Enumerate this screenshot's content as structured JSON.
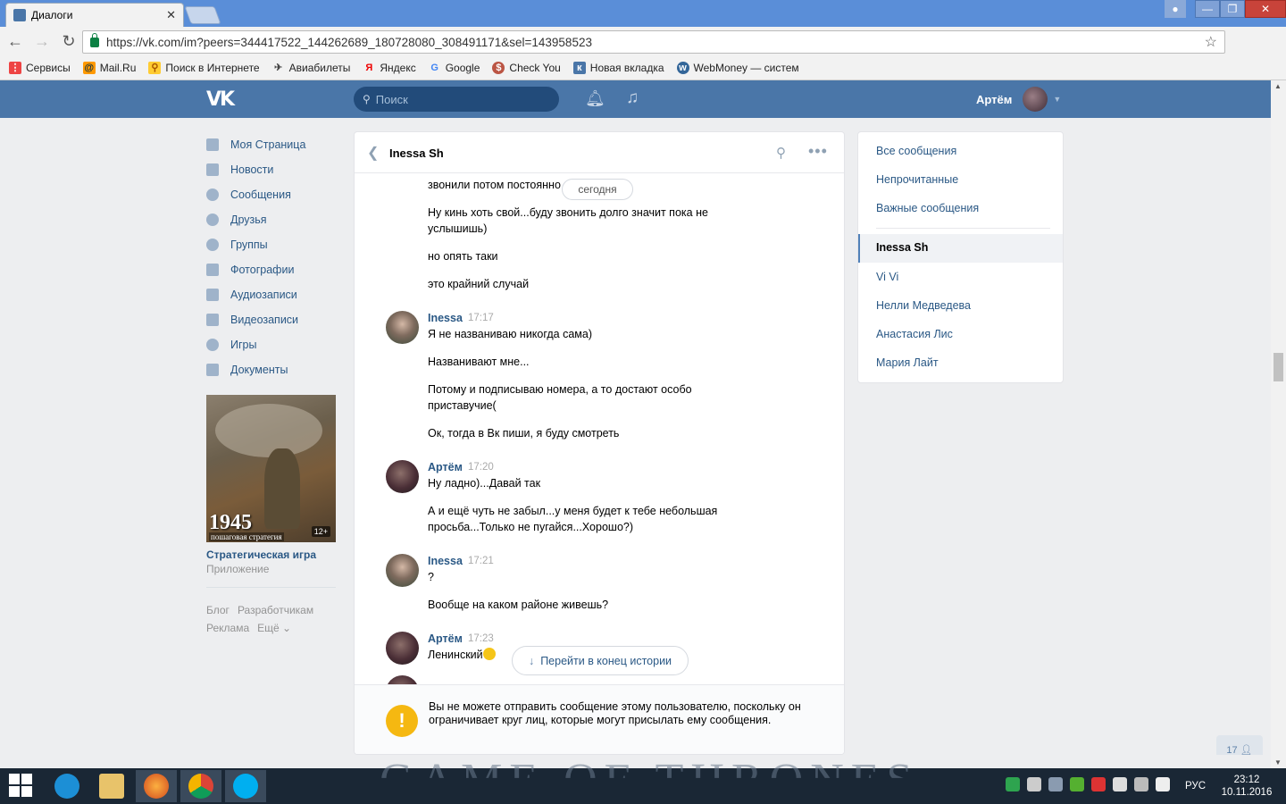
{
  "browser": {
    "tab_title": "Диалоги",
    "url": "https://vk.com/im?peers=344417522_144262689_180728080_308491171&sel=143958523",
    "bookmarks": [
      {
        "label": "Сервисы"
      },
      {
        "label": "Mail.Ru"
      },
      {
        "label": "Поиск в Интернете"
      },
      {
        "label": "Авиабилеты"
      },
      {
        "label": "Яндекс"
      },
      {
        "label": "Google"
      },
      {
        "label": "Check You"
      },
      {
        "label": "Новая вкладка"
      },
      {
        "label": "WebMoney — систем"
      }
    ]
  },
  "header": {
    "search_placeholder": "Поиск",
    "user_name": "Артём"
  },
  "left_menu": {
    "items": [
      {
        "label": "Моя Страница"
      },
      {
        "label": "Новости"
      },
      {
        "label": "Сообщения"
      },
      {
        "label": "Друзья"
      },
      {
        "label": "Группы"
      },
      {
        "label": "Фотографии"
      },
      {
        "label": "Аудиозаписи"
      },
      {
        "label": "Видеозаписи"
      },
      {
        "label": "Игры"
      },
      {
        "label": "Документы"
      }
    ],
    "promo": {
      "year": "1945",
      "image_caption": "пошаговая стратегия",
      "age": "12+",
      "title": "Стратегическая игра",
      "subtitle": "Приложение"
    },
    "footer": {
      "blog": "Блог",
      "developers": "Разработчикам",
      "ads": "Реклама",
      "more": "Ещё ⌄"
    }
  },
  "chat": {
    "name": "Inessa Sh",
    "date_divider": "сегодня",
    "top_partial": "звонили потом постоянно",
    "messages": [
      {
        "text": "Ну кинь хоть свой...буду звонить долго значит пока не услышишь)"
      },
      {
        "text": "но опять таки"
      },
      {
        "text": "это крайний случай"
      }
    ],
    "groups": [
      {
        "author": "Inessa",
        "time": "17:17",
        "messages": [
          "Я не названиваю никогда сама)",
          "Названивают мне...",
          "Потому и подписываю номера, а то достают особо приставучие(",
          "Ок, тогда в Вк пиши, я буду смотреть"
        ]
      },
      {
        "author": "Артём",
        "time": "17:20",
        "messages": [
          "Ну ладно)...Давай так",
          "А и ещё чуть не забыл...у меня будет к тебе небольшая просьба...Только не пугайся...Хорошо?)"
        ]
      },
      {
        "author": "Inessa",
        "time": "17:21",
        "messages": [
          "?",
          "Вообще на каком районе живешь?"
        ]
      },
      {
        "author": "Артём",
        "time": "17:23",
        "messages": [
          "Ленинский"
        ]
      }
    ],
    "jump_button": "Перейти в конец истории",
    "blocked_notice": "Вы не можете отправить сообщение этому пользователю, поскольку он ограничивает круг лиц, которые могут присылать ему сообщения."
  },
  "right_panel": {
    "filters": [
      "Все сообщения",
      "Непрочитанные",
      "Важные сообщения"
    ],
    "active_dialog": "Inessa Sh",
    "dialogs": [
      "Vi Vi",
      "Нелли Медведева",
      "Анастасия Лис",
      "Мария Лайт"
    ]
  },
  "online_counter": "17",
  "taskbar": {
    "language": "РУС",
    "time": "23:12",
    "date": "10.11.2016"
  },
  "colors": {
    "vk_blue": "#4a76a8",
    "link": "#2a5885",
    "warning": "#f5b811"
  }
}
